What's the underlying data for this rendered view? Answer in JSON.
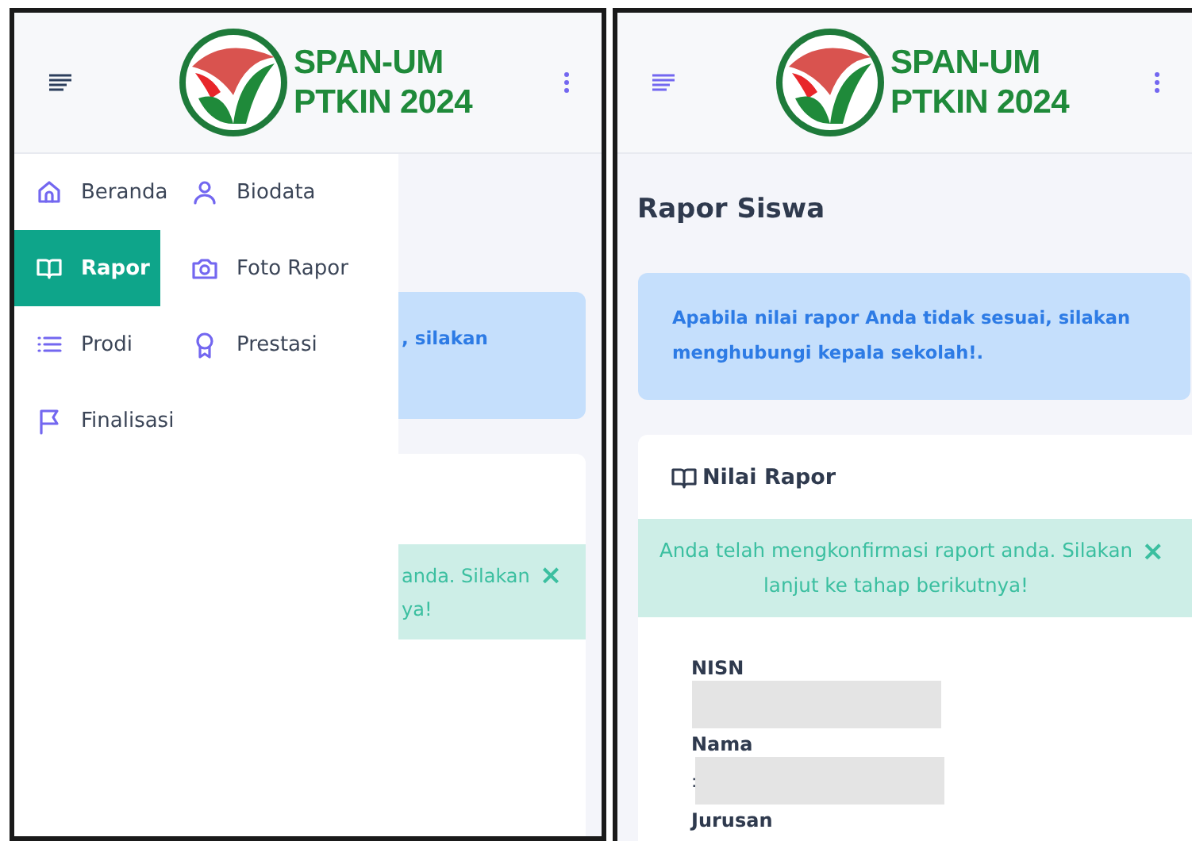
{
  "left_screen": {
    "header": {
      "logo_line1": "SPAN-UM",
      "logo_line2": "PTKIN 2024",
      "menu_open": true
    },
    "nav_menu": {
      "items": [
        {
          "label": "Beranda",
          "selected": false
        },
        {
          "label": "Biodata",
          "selected": false
        },
        {
          "label": "Rapor",
          "selected": true
        },
        {
          "label": "Foto Rapor",
          "selected": false
        },
        {
          "label": "Prodi",
          "selected": false
        },
        {
          "label": "Prestasi",
          "selected": false
        },
        {
          "label": "Finalisasi",
          "selected": false
        }
      ]
    },
    "behind_menu": {
      "info_alert_text": ", silakan",
      "success_alert_lines": [
        "anda. Silakan",
        "ya!"
      ],
      "success_alert_close": "×"
    }
  },
  "right_screen": {
    "header": {
      "logo_line1": "SPAN-UM",
      "logo_line2": "PTKIN 2024",
      "menu_open": false
    },
    "page_title": "Rapor Siswa",
    "info_alert": "Apabila nilai rapor Anda tidak sesuai, silakan menghubungi kepala sekolah!.",
    "card": {
      "title": "Nilai Rapor",
      "success_alert": "Anda telah mengkonfirmasi raport anda. Silakan lanjut ke tahap berikutnya!",
      "success_alert_close": "×",
      "fields": [
        {
          "label": "NISN",
          "redacted": true
        },
        {
          "label": "Nama",
          "prefix": ":",
          "redacted": true
        },
        {
          "label": "Jurusan",
          "redacted": false
        }
      ]
    }
  }
}
